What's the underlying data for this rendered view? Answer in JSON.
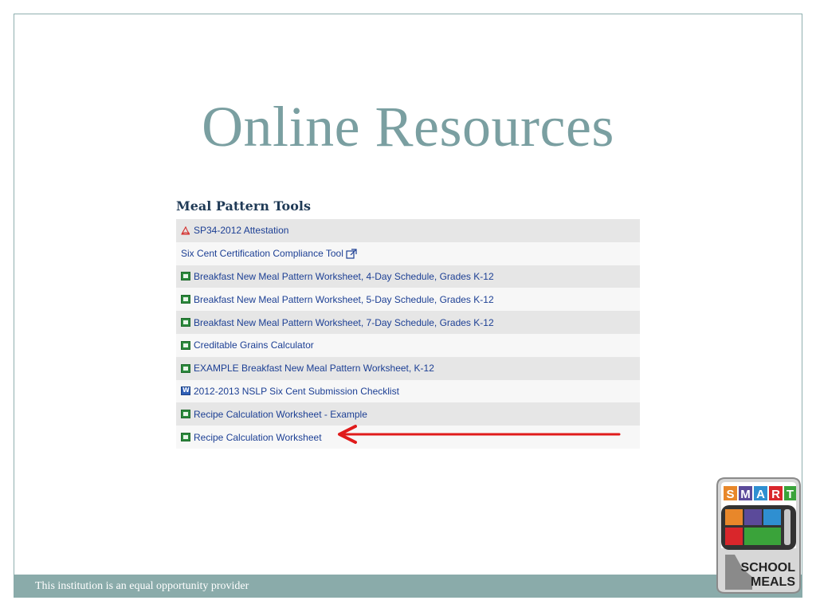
{
  "slide": {
    "title": "Online Resources",
    "footer": "This institution is an equal opportunity provider"
  },
  "section": {
    "heading": "Meal Pattern Tools",
    "items": [
      {
        "label": "SP34-2012 Attestation",
        "icon": "pdf-icon"
      },
      {
        "label": "Six Cent Certification Compliance Tool",
        "icon": "external-link-icon"
      },
      {
        "label": "Breakfast New Meal Pattern Worksheet, 4-Day Schedule, Grades K-12",
        "icon": "excel-icon"
      },
      {
        "label": "Breakfast New Meal Pattern Worksheet, 5-Day Schedule, Grades K-12",
        "icon": "excel-icon"
      },
      {
        "label": "Breakfast New Meal Pattern Worksheet, 7-Day Schedule, Grades K-12",
        "icon": "excel-icon"
      },
      {
        "label": "Creditable Grains Calculator",
        "icon": "excel-icon"
      },
      {
        "label": "EXAMPLE Breakfast New Meal Pattern Worksheet, K-12",
        "icon": "excel-icon"
      },
      {
        "label": "2012-2013 NSLP Six Cent Submission Checklist",
        "icon": "word-icon"
      },
      {
        "label": "Recipe Calculation Worksheet - Example",
        "icon": "excel-icon"
      },
      {
        "label": "Recipe Calculation Worksheet",
        "icon": "excel-icon"
      }
    ]
  },
  "logo": {
    "letters": [
      "S",
      "M",
      "A",
      "R",
      "T"
    ],
    "line1": "SCHOOL",
    "line2": "MEALS"
  },
  "colors": {
    "title": "#7a9fa1",
    "link": "#1c3f94",
    "arrow": "#e01b1b",
    "footer_bg": "#8aabaa"
  }
}
